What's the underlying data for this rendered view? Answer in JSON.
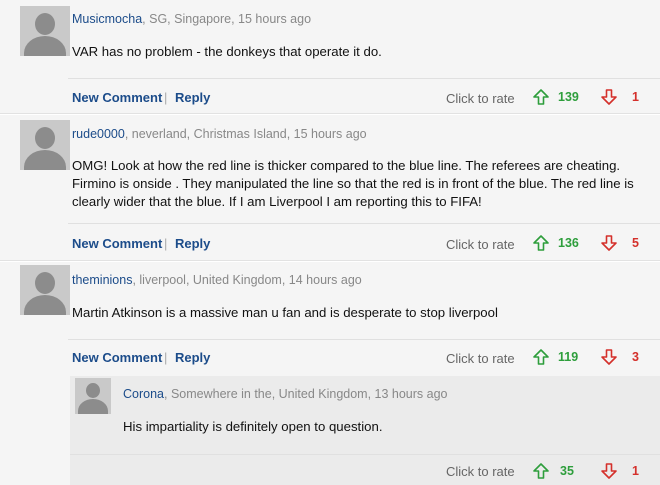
{
  "comments": [
    {
      "username": "Musicmocha",
      "location": ", SG, Singapore, 15 hours ago",
      "text": "VAR has no problem - the donkeys that operate it do.",
      "new_comment": "New Comment",
      "reply": "Reply",
      "rate_label": "Click to rate",
      "up": "139",
      "down": "1"
    },
    {
      "username": "rude0000",
      "location": ", neverland, Christmas Island, 15 hours ago",
      "text": "OMG! Look at how the red line is thicker compared to the blue line. The referees are cheating. Firmino is onside . They manipulated the line so that the red is in front of the blue. The red line is clearly wider that the blue. If I am Liverpool I am reporting this to FIFA!",
      "new_comment": "New Comment",
      "reply": "Reply",
      "rate_label": "Click to rate",
      "up": "136",
      "down": "5"
    },
    {
      "username": "theminions",
      "location": ", liverpool, United Kingdom, 14 hours ago",
      "text": "Martin Atkinson is a massive man u fan and is desperate to stop liverpool",
      "new_comment": "New Comment",
      "reply": "Reply",
      "rate_label": "Click to rate",
      "up": "119",
      "down": "3"
    },
    {
      "username": "Corona",
      "location": ", Somewhere in the, United Kingdom, 13 hours ago",
      "text": "His impartiality is definitely open to question.",
      "rate_label": "Click to rate",
      "up": "35",
      "down": "1"
    }
  ],
  "colors": {
    "up": "#2e9e3c",
    "down": "#d4302b",
    "link": "#1c4c8a"
  },
  "icons": {
    "avatar": "avatar-placeholder",
    "up": "arrow-up-outline",
    "down": "arrow-down-outline"
  }
}
